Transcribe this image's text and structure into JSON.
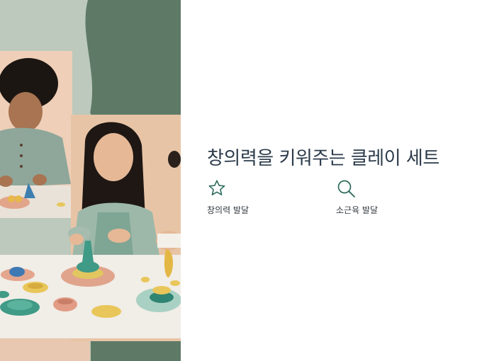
{
  "slide": {
    "title": "창의력을 키워주는 클레이 세트",
    "features": [
      {
        "label": "창의력 발달",
        "icon": "star-icon"
      },
      {
        "label": "소근육 발달",
        "icon": "search-icon"
      }
    ]
  },
  "colors": {
    "accent": "#2e6b5c",
    "title_text": "#2b3a4a",
    "panel_green": "#5e7a67",
    "panel_sage": "#bcc9bc",
    "backdrop_peach": "#ebcdb4"
  },
  "hero_image": {
    "description_icon": "children-playing-with-clay-photo"
  }
}
